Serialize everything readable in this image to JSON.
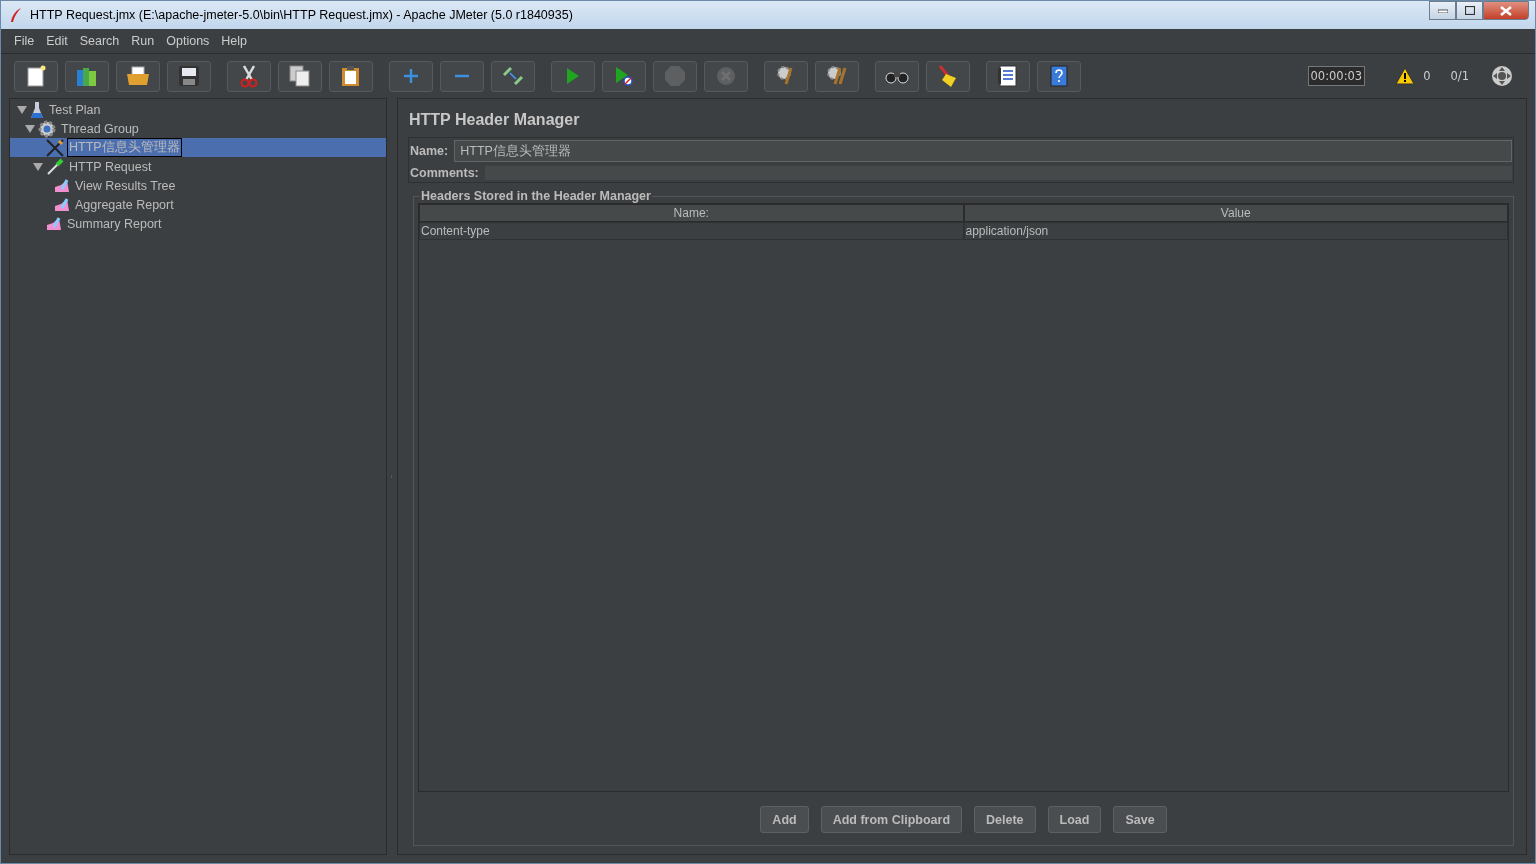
{
  "window": {
    "title": "HTTP Request.jmx (E:\\apache-jmeter-5.0\\bin\\HTTP Request.jmx) - Apache JMeter (5.0 r1840935)"
  },
  "menu": [
    "File",
    "Edit",
    "Search",
    "Run",
    "Options",
    "Help"
  ],
  "toolbar": [
    [
      {
        "kind": "new",
        "disabled": false
      },
      {
        "kind": "templates",
        "disabled": false
      },
      {
        "kind": "open",
        "disabled": false
      },
      {
        "kind": "save",
        "disabled": false
      }
    ],
    [
      {
        "kind": "cut",
        "disabled": false
      },
      {
        "kind": "copy",
        "disabled": false
      },
      {
        "kind": "paste",
        "disabled": false
      }
    ],
    [
      {
        "kind": "expand",
        "disabled": false
      },
      {
        "kind": "collapse",
        "disabled": false
      },
      {
        "kind": "toggle",
        "disabled": false
      }
    ],
    [
      {
        "kind": "start",
        "disabled": false
      },
      {
        "kind": "start-no-pause",
        "disabled": false
      },
      {
        "kind": "stop",
        "disabled": true
      },
      {
        "kind": "shutdown",
        "disabled": true
      }
    ],
    [
      {
        "kind": "clear",
        "disabled": false
      },
      {
        "kind": "clear-all",
        "disabled": false
      }
    ],
    [
      {
        "kind": "search",
        "disabled": false
      },
      {
        "kind": "reset-search",
        "disabled": false
      }
    ],
    [
      {
        "kind": "function-helper",
        "disabled": false
      },
      {
        "kind": "help",
        "disabled": false
      }
    ]
  ],
  "status": {
    "elapsed": "00:00:03",
    "warnings": "0",
    "threads": "0/1"
  },
  "tree": [
    {
      "label": "Test Plan",
      "kind": "plan",
      "expanded": true,
      "selected": false,
      "children": [
        {
          "label": "Thread Group",
          "kind": "threads",
          "expanded": true,
          "selected": false,
          "children": [
            {
              "label": "HTTP信息头管理器",
              "kind": "config",
              "selected": true
            },
            {
              "label": "HTTP Request",
              "kind": "sampler",
              "expanded": true,
              "selected": false,
              "children": [
                {
                  "label": "View Results Tree",
                  "kind": "listener",
                  "selected": false
                },
                {
                  "label": "Aggregate Report",
                  "kind": "listener",
                  "selected": false
                }
              ]
            },
            {
              "label": "Summary Report",
              "kind": "listener",
              "selected": false
            }
          ]
        }
      ]
    }
  ],
  "panel": {
    "title": "HTTP Header Manager",
    "name_label": "Name:",
    "name_value": "HTTP信息头管理器",
    "comments_label": "Comments:",
    "group_title": "Headers Stored in the Header Manager",
    "columns": [
      "Name:",
      "Value"
    ],
    "rows": [
      [
        "Content-type",
        "application/json"
      ]
    ],
    "buttons": [
      "Add",
      "Add from Clipboard",
      "Delete",
      "Load",
      "Save"
    ]
  }
}
